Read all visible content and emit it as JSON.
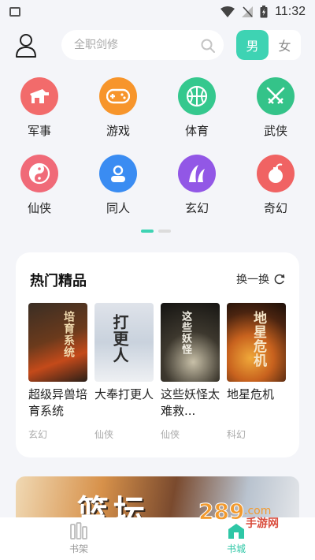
{
  "status_bar": {
    "time": "11:32"
  },
  "header": {
    "search": {
      "placeholder": "全职剑修"
    },
    "gender": {
      "male": "男",
      "female": "女",
      "selected": "男"
    }
  },
  "categories": [
    {
      "label": "军事",
      "icon": "tank-icon",
      "color": "#f26b6b"
    },
    {
      "label": "游戏",
      "icon": "gamepad-icon",
      "color": "#f7952b"
    },
    {
      "label": "体育",
      "icon": "basketball-icon",
      "color": "#35c88e"
    },
    {
      "label": "武侠",
      "icon": "crossed-swords-icon",
      "color": "#34c389"
    },
    {
      "label": "仙侠",
      "icon": "yin-yang-icon",
      "color": "#f06a78"
    },
    {
      "label": "同人",
      "icon": "person-icon",
      "color": "#3a8cf2"
    },
    {
      "label": "玄幻",
      "icon": "mountain-icon",
      "color": "#9257e6"
    },
    {
      "label": "奇幻",
      "icon": "bomb-icon",
      "color": "#f06363"
    }
  ],
  "hot": {
    "title": "热门精品",
    "refresh_label": "换一换",
    "books": [
      {
        "name": "超级异兽培育系统",
        "genre": "玄幻",
        "cover_text": "培育系统"
      },
      {
        "name": "大奉打更人",
        "genre": "仙侠",
        "cover_text": "打更人"
      },
      {
        "name": "这些妖怪太难救...",
        "genre": "仙侠",
        "cover_text": "这些妖怪"
      },
      {
        "name": "地星危机",
        "genre": "科幻",
        "cover_text": "地星危机"
      }
    ]
  },
  "banner": {
    "text": "篮坛"
  },
  "bottom_nav": {
    "bookshelf": "书架",
    "bookstore": "书城",
    "active": "书城"
  },
  "watermark": {
    "text": "289 手游网"
  }
}
